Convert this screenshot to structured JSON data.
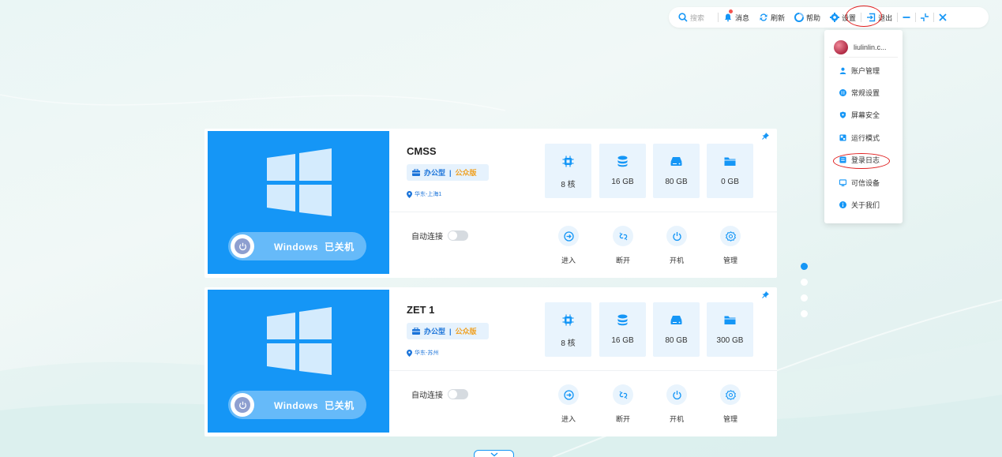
{
  "toolbar": {
    "search_placeholder": "搜索",
    "messages": "消息",
    "refresh": "刷新",
    "help": "帮助",
    "settings": "设置",
    "logout": "退出"
  },
  "menu": {
    "user": "liulinlin.c...",
    "items": [
      {
        "label": "账户管理",
        "icon": "user-icon"
      },
      {
        "label": "常规设置",
        "icon": "settings-icon"
      },
      {
        "label": "屏幕安全",
        "icon": "shield-icon"
      },
      {
        "label": "运行模式",
        "icon": "mode-icon"
      },
      {
        "label": "登录日志",
        "icon": "log-icon"
      },
      {
        "label": "可信设备",
        "icon": "monitor-icon"
      },
      {
        "label": "关于我们",
        "icon": "info-icon"
      }
    ]
  },
  "desktops": [
    {
      "name": "CMSS",
      "os": "Windows",
      "state": "已关机",
      "tag_type": "办公型",
      "tag_sep": "|",
      "tag_edition": "公众版",
      "region": "华东-上海1",
      "auto_connect_label": "自动连接",
      "auto_connect": false,
      "specs": {
        "cpu": "8 核",
        "memory": "16 GB",
        "system_disk": "80 GB",
        "data_disk": "0 GB"
      },
      "actions": {
        "enter": "进入",
        "disconnect": "断开",
        "power_on": "开机",
        "manage": "管理"
      }
    },
    {
      "name": "ZET 1",
      "os": "Windows",
      "state": "已关机",
      "tag_type": "办公型",
      "tag_sep": "|",
      "tag_edition": "公众版",
      "region": "华东-苏州",
      "auto_connect_label": "自动连接",
      "auto_connect": false,
      "specs": {
        "cpu": "8 核",
        "memory": "16 GB",
        "system_disk": "80 GB",
        "data_disk": "300 GB"
      },
      "actions": {
        "enter": "进入",
        "disconnect": "断开",
        "power_on": "开机",
        "manage": "管理"
      }
    }
  ],
  "pager": {
    "pages": 4,
    "current": 1
  },
  "colors": {
    "primary": "#1596f6",
    "accent_orange": "#f0a020",
    "highlight_ring": "#e02020"
  }
}
